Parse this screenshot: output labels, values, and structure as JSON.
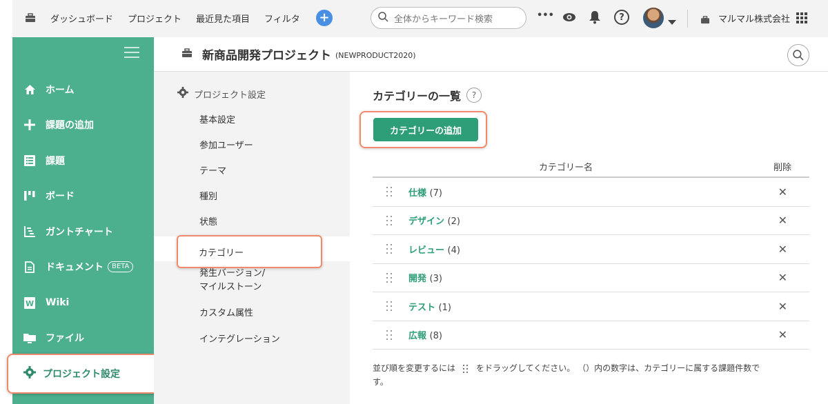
{
  "topbar": {
    "items": [
      "ダッシュボード",
      "プロジェクト",
      "最近見た項目",
      "フィルタ"
    ],
    "search_placeholder": "全体からキーワード検索",
    "more": "•••",
    "help": "?",
    "org_name": "マルマル株式会社"
  },
  "sidebar": {
    "items": [
      {
        "label": "ホーム",
        "icon": "home-icon"
      },
      {
        "label": "課題の追加",
        "icon": "plus-icon"
      },
      {
        "label": "課題",
        "icon": "list-icon"
      },
      {
        "label": "ボード",
        "icon": "board-icon"
      },
      {
        "label": "ガントチャート",
        "icon": "gantt-icon"
      },
      {
        "label": "ドキュメント",
        "icon": "document-icon",
        "badge": "BETA"
      },
      {
        "label": "Wiki",
        "icon": "wiki-icon"
      },
      {
        "label": "ファイル",
        "icon": "folder-icon"
      }
    ],
    "active": {
      "label": "プロジェクト設定",
      "icon": "gear-icon"
    }
  },
  "header": {
    "project_name": "新商品開発プロジェクト",
    "project_code": "(NEWPRODUCT2020)"
  },
  "subnav": {
    "heading": "プロジェクト設定",
    "items": [
      "基本設定",
      "参加ユーザー",
      "テーマ",
      "種別",
      "状態",
      "カテゴリー",
      "発生バージョン/",
      "マイルストーン",
      "カスタム属性",
      "インテグレーション"
    ]
  },
  "main": {
    "title": "カテゴリーの一覧",
    "help": "?",
    "add_button": "カテゴリーの追加",
    "col_name": "カテゴリー名",
    "col_delete": "削除",
    "rows": [
      {
        "name": "仕様",
        "count": "(7)"
      },
      {
        "name": "デザイン",
        "count": "(2)"
      },
      {
        "name": "レビュー",
        "count": "(4)"
      },
      {
        "name": "開発",
        "count": "(3)"
      },
      {
        "name": "テスト",
        "count": "(1)"
      },
      {
        "name": "広報",
        "count": "(8)"
      }
    ],
    "delete_glyph": "✕",
    "note_before": "並び順を変更するには",
    "note_after": "をドラッグしてください。 （）内の数字は、カテゴリーに属する課題件数で",
    "note_line2": "す。"
  },
  "colors": {
    "accent": "#4caf8e",
    "link": "#2e9e78",
    "highlight": "#f08a6a"
  }
}
